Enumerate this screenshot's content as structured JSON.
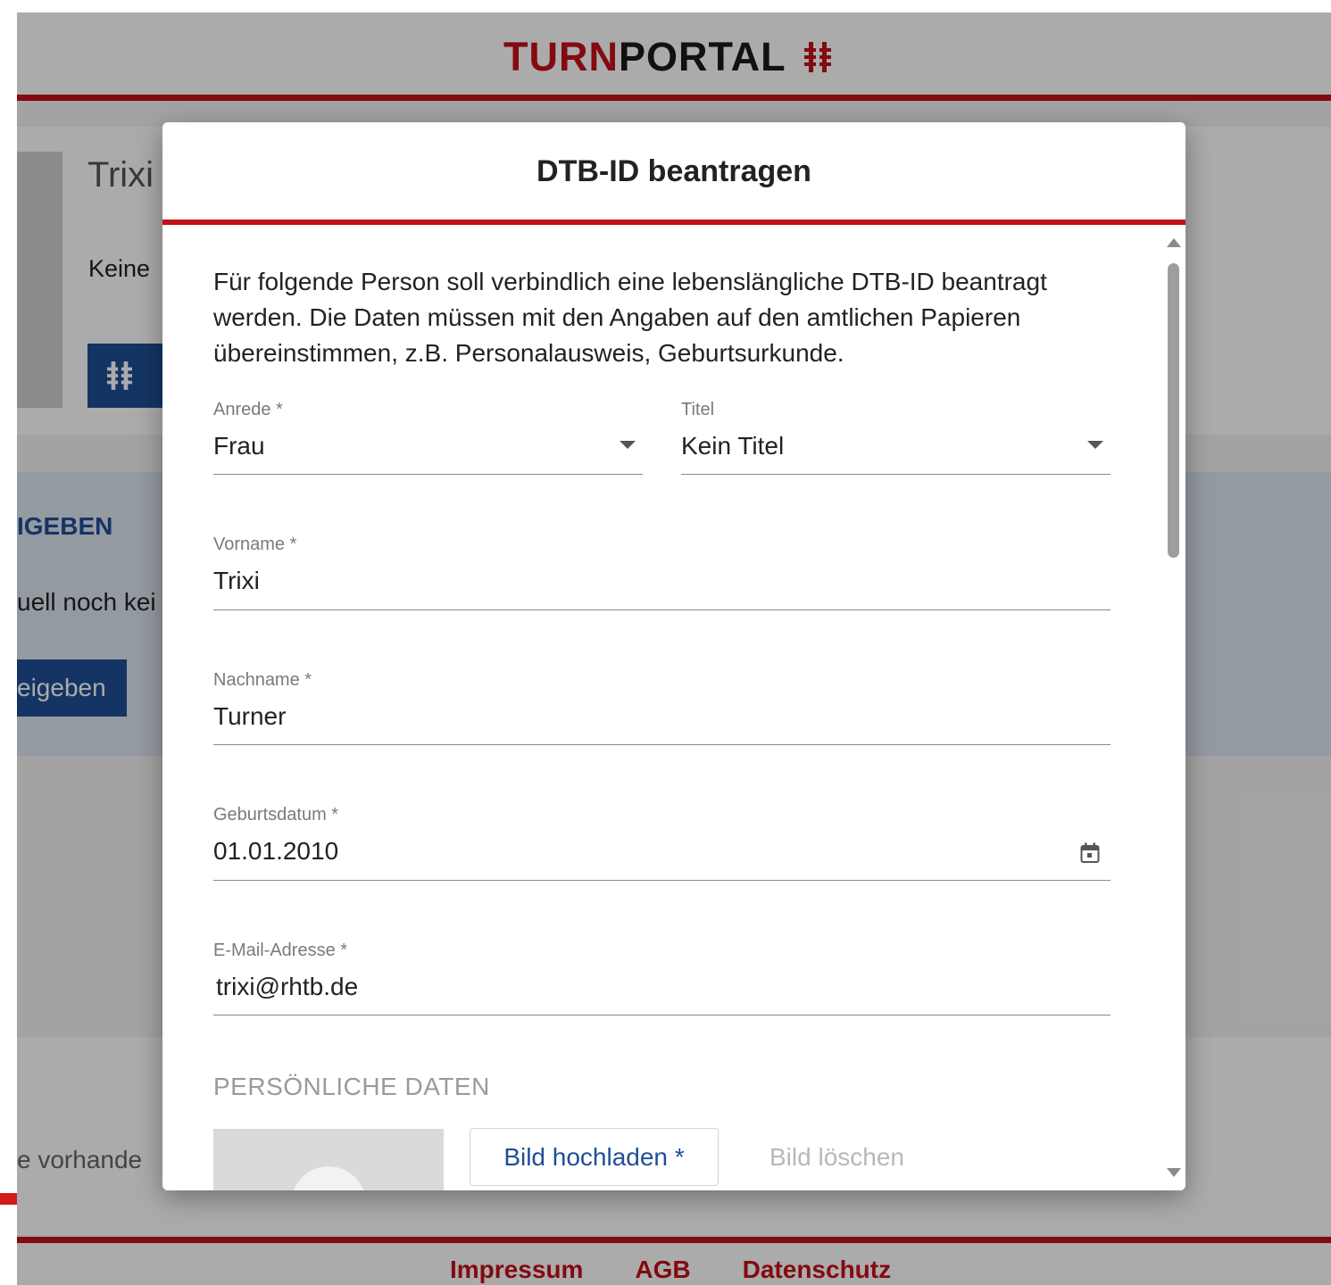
{
  "header": {
    "logo_turn": "TURN",
    "logo_portal": "PORTAL"
  },
  "background": {
    "profile_name": "Trixi",
    "dtb_status": "Keine",
    "share_heading": "IGEBEN",
    "share_text": "uell noch kei",
    "share_button": "eigeben",
    "lower_text": "e vorhande"
  },
  "footer": {
    "links": [
      "Impressum",
      "AGB",
      "Datenschutz"
    ]
  },
  "dialog": {
    "title": "DTB-ID beantragen",
    "intro": "Für folgende Person soll verbindlich eine lebenslängliche DTB-ID beantragt werden. Die Daten müssen mit den Angaben auf den amtlichen Papieren übereinstimmen, z.B. Personalausweis, Geburtsurkunde.",
    "fields": {
      "anrede": {
        "label": "Anrede *",
        "value": "Frau"
      },
      "titel": {
        "label": "Titel",
        "value": "Kein Titel"
      },
      "vorname": {
        "label": "Vorname *",
        "value": "Trixi"
      },
      "nachname": {
        "label": "Nachname *",
        "value": "Turner"
      },
      "geburtsdatum": {
        "label": "Geburtsdatum *",
        "value": "01.01.2010"
      },
      "email": {
        "label": "E-Mail-Adresse *",
        "value": "trixi@rhtb.de"
      }
    },
    "section_personal": "PERSÖNLICHE DATEN",
    "upload_button": "Bild hochladen *",
    "delete_button": "Bild löschen"
  },
  "icons": {
    "logo_mark": "turner-cross-icon",
    "dropdown": "chevron-down-icon",
    "calendar": "calendar-icon"
  },
  "colors": {
    "brand_red": "#c41018",
    "brand_blue": "#1f4f96"
  }
}
